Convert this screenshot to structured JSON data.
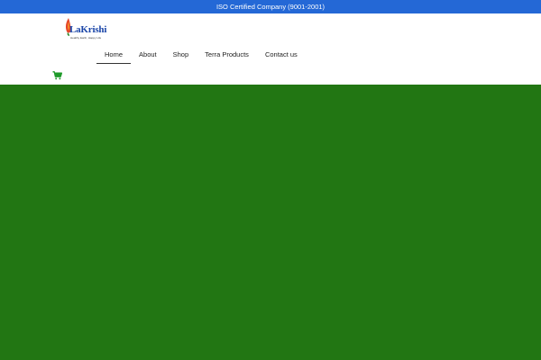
{
  "topbar": {
    "text": "ISO Certified Company (9001-2001)"
  },
  "logo": {
    "name": "LaKrishi",
    "tagline": "Healthy Earth, Happy Life"
  },
  "nav": {
    "items": [
      {
        "label": "Home",
        "active": true
      },
      {
        "label": "About"
      },
      {
        "label": "Shop"
      },
      {
        "label": "Terra Products"
      },
      {
        "label": "Contact us"
      }
    ]
  },
  "colors": {
    "topbar": "#2468d6",
    "hero": "#227613",
    "cart": "#1f9a2a",
    "logo_text": "#1a45a8"
  },
  "icons": {
    "cart": "shopping-cart-icon",
    "logo": "flame-leaf-icon"
  }
}
